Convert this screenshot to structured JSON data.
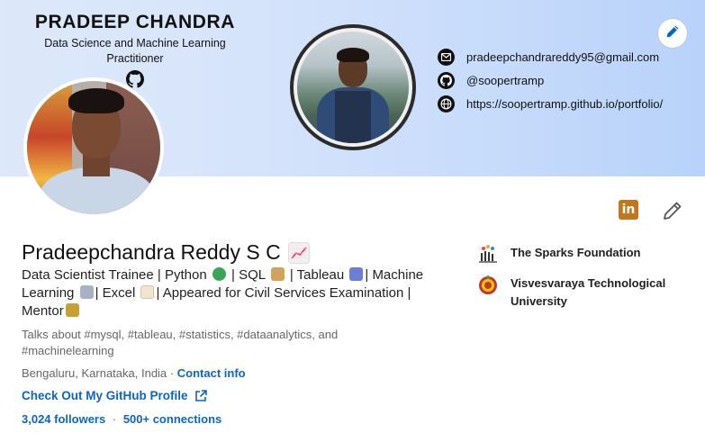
{
  "banner": {
    "name": "PRADEEP CHANDRA",
    "tagline": "Data Science and Machine Learning Practitioner",
    "contacts": {
      "email": "pradeepchandrareddy95@gmail.com",
      "github": "@soopertramp",
      "website": "https://soopertramp.github.io/portfolio/"
    }
  },
  "profile": {
    "full_name": "Pradeepchandra Reddy S C",
    "headline_parts": [
      "Data Scientist Trainee | Python ",
      " | SQL ",
      " | Tableau ",
      "| Machine Learning ",
      "| Excel ",
      "| Appeared for Civil Services Examination | Mentor"
    ],
    "talks_about": "Talks about #mysql, #tableau, #statistics, #dataanalytics, and #machinelearning",
    "location": "Bengaluru, Karnataka, India",
    "location_separator": "·",
    "contact_info_label": "Contact info",
    "github_link_label": "Check Out My GitHub Profile",
    "followers": "3,024 followers",
    "stats_separator": "·",
    "connections": "500+ connections"
  },
  "organizations": [
    {
      "name": "The Sparks Foundation"
    },
    {
      "name": "Visvesvaraya Technological University"
    }
  ],
  "colors": {
    "link_blue": "#0a66c2",
    "linkedin_badge": "#c4761c"
  },
  "icons": {
    "email": "envelope-icon",
    "github": "github-icon",
    "website": "globe-icon",
    "edit": "pencil-icon",
    "external": "external-link-icon"
  }
}
